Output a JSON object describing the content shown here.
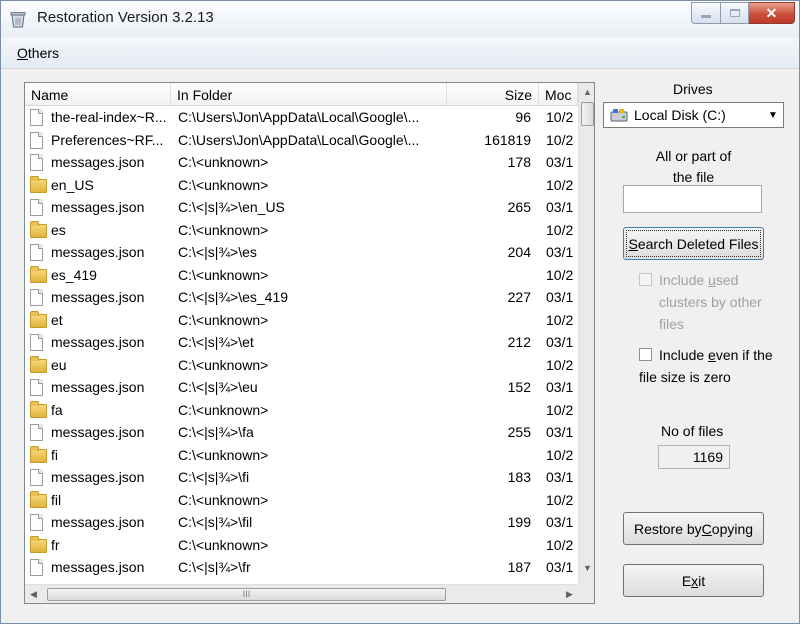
{
  "window": {
    "title": "Restoration Version 3.2.13"
  },
  "menu": {
    "others_acc": "O",
    "others_rest": "thers"
  },
  "list": {
    "columns": {
      "name": "Name",
      "folder": "In Folder",
      "size": "Size",
      "modified": "Moc"
    },
    "rows": [
      {
        "type": "file",
        "name": "the-real-index~R...",
        "folder": "C:\\Users\\Jon\\AppData\\Local\\Google\\...",
        "size": "96",
        "modified": "10/2"
      },
      {
        "type": "file",
        "name": "Preferences~RF...",
        "folder": "C:\\Users\\Jon\\AppData\\Local\\Google\\...",
        "size": "161819",
        "modified": "10/2"
      },
      {
        "type": "file",
        "name": "messages.json",
        "folder": "C:\\<unknown>",
        "size": "178",
        "modified": "03/1"
      },
      {
        "type": "folder",
        "name": "en_US",
        "folder": "C:\\<unknown>",
        "size": "",
        "modified": "10/2"
      },
      {
        "type": "file",
        "name": "messages.json",
        "folder": "C:\\<|s|¾>\\en_US",
        "size": "265",
        "modified": "03/1"
      },
      {
        "type": "folder",
        "name": "es",
        "folder": "C:\\<unknown>",
        "size": "",
        "modified": "10/2"
      },
      {
        "type": "file",
        "name": "messages.json",
        "folder": "C:\\<|s|¾>\\es",
        "size": "204",
        "modified": "03/1"
      },
      {
        "type": "folder",
        "name": "es_419",
        "folder": "C:\\<unknown>",
        "size": "",
        "modified": "10/2"
      },
      {
        "type": "file",
        "name": "messages.json",
        "folder": "C:\\<|s|¾>\\es_419",
        "size": "227",
        "modified": "03/1"
      },
      {
        "type": "folder",
        "name": "et",
        "folder": "C:\\<unknown>",
        "size": "",
        "modified": "10/2"
      },
      {
        "type": "file",
        "name": "messages.json",
        "folder": "C:\\<|s|¾>\\et",
        "size": "212",
        "modified": "03/1"
      },
      {
        "type": "folder",
        "name": "eu",
        "folder": "C:\\<unknown>",
        "size": "",
        "modified": "10/2"
      },
      {
        "type": "file",
        "name": "messages.json",
        "folder": "C:\\<|s|¾>\\eu",
        "size": "152",
        "modified": "03/1"
      },
      {
        "type": "folder",
        "name": "fa",
        "folder": "C:\\<unknown>",
        "size": "",
        "modified": "10/2"
      },
      {
        "type": "file",
        "name": "messages.json",
        "folder": "C:\\<|s|¾>\\fa",
        "size": "255",
        "modified": "03/1"
      },
      {
        "type": "folder",
        "name": "fi",
        "folder": "C:\\<unknown>",
        "size": "",
        "modified": "10/2"
      },
      {
        "type": "file",
        "name": "messages.json",
        "folder": "C:\\<|s|¾>\\fi",
        "size": "183",
        "modified": "03/1"
      },
      {
        "type": "folder",
        "name": "fil",
        "folder": "C:\\<unknown>",
        "size": "",
        "modified": "10/2"
      },
      {
        "type": "file",
        "name": "messages.json",
        "folder": "C:\\<|s|¾>\\fil",
        "size": "199",
        "modified": "03/1"
      },
      {
        "type": "folder",
        "name": "fr",
        "folder": "C:\\<unknown>",
        "size": "",
        "modified": "10/2"
      },
      {
        "type": "file",
        "name": "messages.json",
        "folder": "C:\\<|s|¾>\\fr",
        "size": "187",
        "modified": "03/1"
      }
    ],
    "hscroll_grip": "III"
  },
  "panel": {
    "drives_label": "Drives",
    "drive_selected": "Local Disk (C:)",
    "allpart_line1": "All or part of",
    "allpart_line2": "the file",
    "file_value": "",
    "search_acc": "S",
    "search_rest": "earch Deleted Files",
    "include_used_pre": "Include ",
    "include_used_acc": "u",
    "include_used_post": "sed clusters by other files",
    "include_even_pre": "Include ",
    "include_even_acc": "e",
    "include_even_post": "ven if the file size is zero",
    "nof_label": "No of files",
    "nof_value": "1169",
    "restore_pre": "Restore by ",
    "restore_acc": "C",
    "restore_post": "opying",
    "exit_pre": "E",
    "exit_acc": "x",
    "exit_post": "it"
  },
  "icons": {
    "app": "recycle-bin-icon",
    "file": "file-icon",
    "folder": "folder-icon",
    "drive": "hard-drive-icon"
  }
}
